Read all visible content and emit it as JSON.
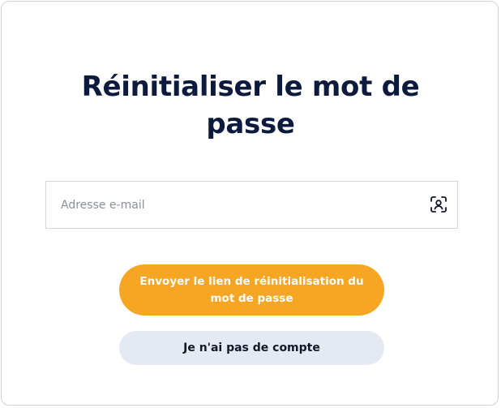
{
  "page": {
    "title_line1": "Réinitialiser le mot de",
    "title_line2": "passe"
  },
  "email": {
    "placeholder": "Adresse e-mail",
    "value": "",
    "icon": "user-scan-icon"
  },
  "actions": {
    "send_reset_label": "Envoyer le lien de réinitialisation du mot de passe",
    "no_account_label": "Je n'ai pas de compte"
  },
  "colors": {
    "title": "#0c1a3d",
    "primary_button": "#f6a623",
    "secondary_button": "#e5eaf2",
    "border": "#d3d6dc"
  }
}
